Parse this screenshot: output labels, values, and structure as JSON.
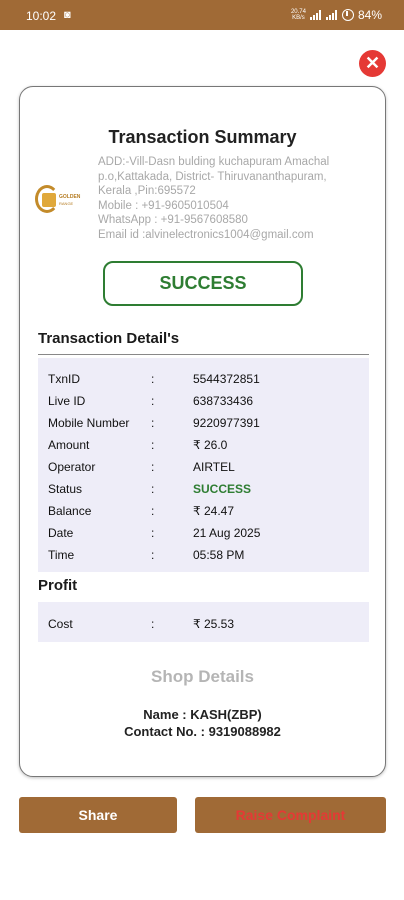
{
  "status_bar": {
    "time": "10:02",
    "network_top": "20.74",
    "network_bottom": "KB/s",
    "battery": "84%"
  },
  "card": {
    "title": "Transaction Summary",
    "logo": {
      "brand_line1": "GOLDEN",
      "brand_line2": "RANGE"
    },
    "address_lines": [
      "ADD:-Vill-Dasn bulding kuchapuram Amachal",
      "p.o,Kattakada, District- Thiruvananthapuram,",
      "Kerala ,Pin:695572",
      "Mobile : +91-9605010504",
      "WhatsApp : +91-9567608580",
      "Email id :alvinelectronics1004@gmail.com"
    ],
    "status_badge": "SUCCESS",
    "transaction_section_title": "Transaction Detail's",
    "details": [
      {
        "label": "TxnID",
        "sep": ":",
        "value": "5544372851"
      },
      {
        "label": "Live ID",
        "sep": ":",
        "value": "638733436"
      },
      {
        "label": "Mobile Number",
        "sep": ":",
        "value": "9220977391"
      },
      {
        "label": "Amount",
        "sep": ":",
        "value": "₹ 26.0"
      },
      {
        "label": "Operator",
        "sep": ":",
        "value": "AIRTEL"
      },
      {
        "label": "Status",
        "sep": ":",
        "value": "SUCCESS"
      },
      {
        "label": "Balance",
        "sep": ":",
        "value": "₹ 24.47"
      },
      {
        "label": "Date",
        "sep": ":",
        "value": "21 Aug 2025"
      },
      {
        "label": "Time",
        "sep": ":",
        "value": "05:58 PM"
      }
    ],
    "profit_section_title": "Profit",
    "profit": {
      "label": "Cost",
      "sep": ":",
      "value": "₹ 25.53"
    },
    "shop_title": "Shop Details",
    "shop_name": "Name  :  KASH(ZBP)",
    "shop_contact": "Contact No.  :  9319088982"
  },
  "buttons": {
    "share": "Share",
    "raise_complaint": "Raise Complaint"
  },
  "colors": {
    "brand_brown": "#a06a36",
    "success_green": "#2e7d32",
    "close_red": "#e53935",
    "panel_bg": "#eeedf8"
  }
}
